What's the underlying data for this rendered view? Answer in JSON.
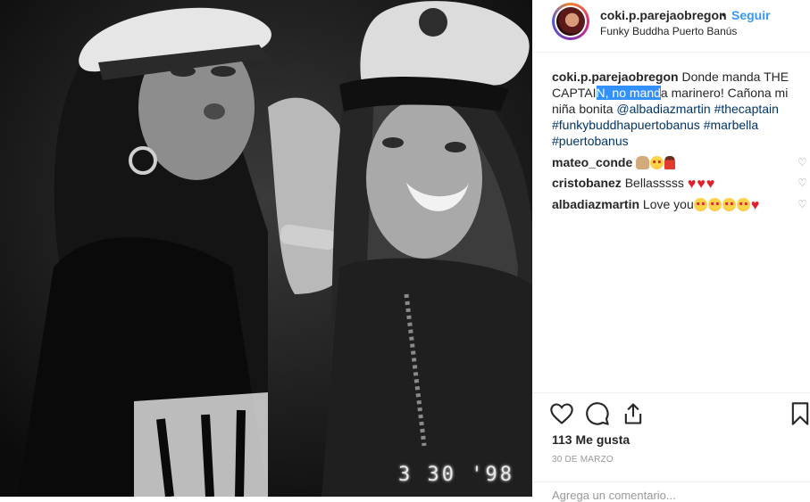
{
  "photo": {
    "datestamp": "3 30 '98"
  },
  "header": {
    "username": "coki.p.parejaobregon",
    "separator": "•",
    "follow_label": "Seguir",
    "location": "Funky Buddha Puerto Banús"
  },
  "caption": {
    "username": "coki.p.parejaobregon",
    "text_before": " Donde manda THE CAPTAI",
    "highlighted": "N, no mand",
    "text_after": "a marinero! Cañona mi niña bonita ",
    "mention": "@albadiazmartin",
    "hashtags": "#thecaptain #funkybuddhapuertobanus #marbella #puertobanus"
  },
  "comments": [
    {
      "username": "mateo_conde",
      "text": "",
      "emojis": [
        "hands",
        "face",
        "dancer"
      ]
    },
    {
      "username": "cristobanez",
      "text": "Bellasssss",
      "emojis": [
        "heart",
        "heart",
        "heart"
      ]
    },
    {
      "username": "albadiazmartin",
      "text": "Love you",
      "emojis": [
        "face",
        "face",
        "face",
        "face",
        "heart"
      ]
    }
  ],
  "icons": [
    "like-heart-icon",
    "comment-icon",
    "share-icon",
    "bookmark-icon",
    "comment-like-heart-icon"
  ],
  "likes": "113 Me gusta",
  "date": "30 DE MARZO",
  "comment_placeholder": "Agrega un comentario..."
}
